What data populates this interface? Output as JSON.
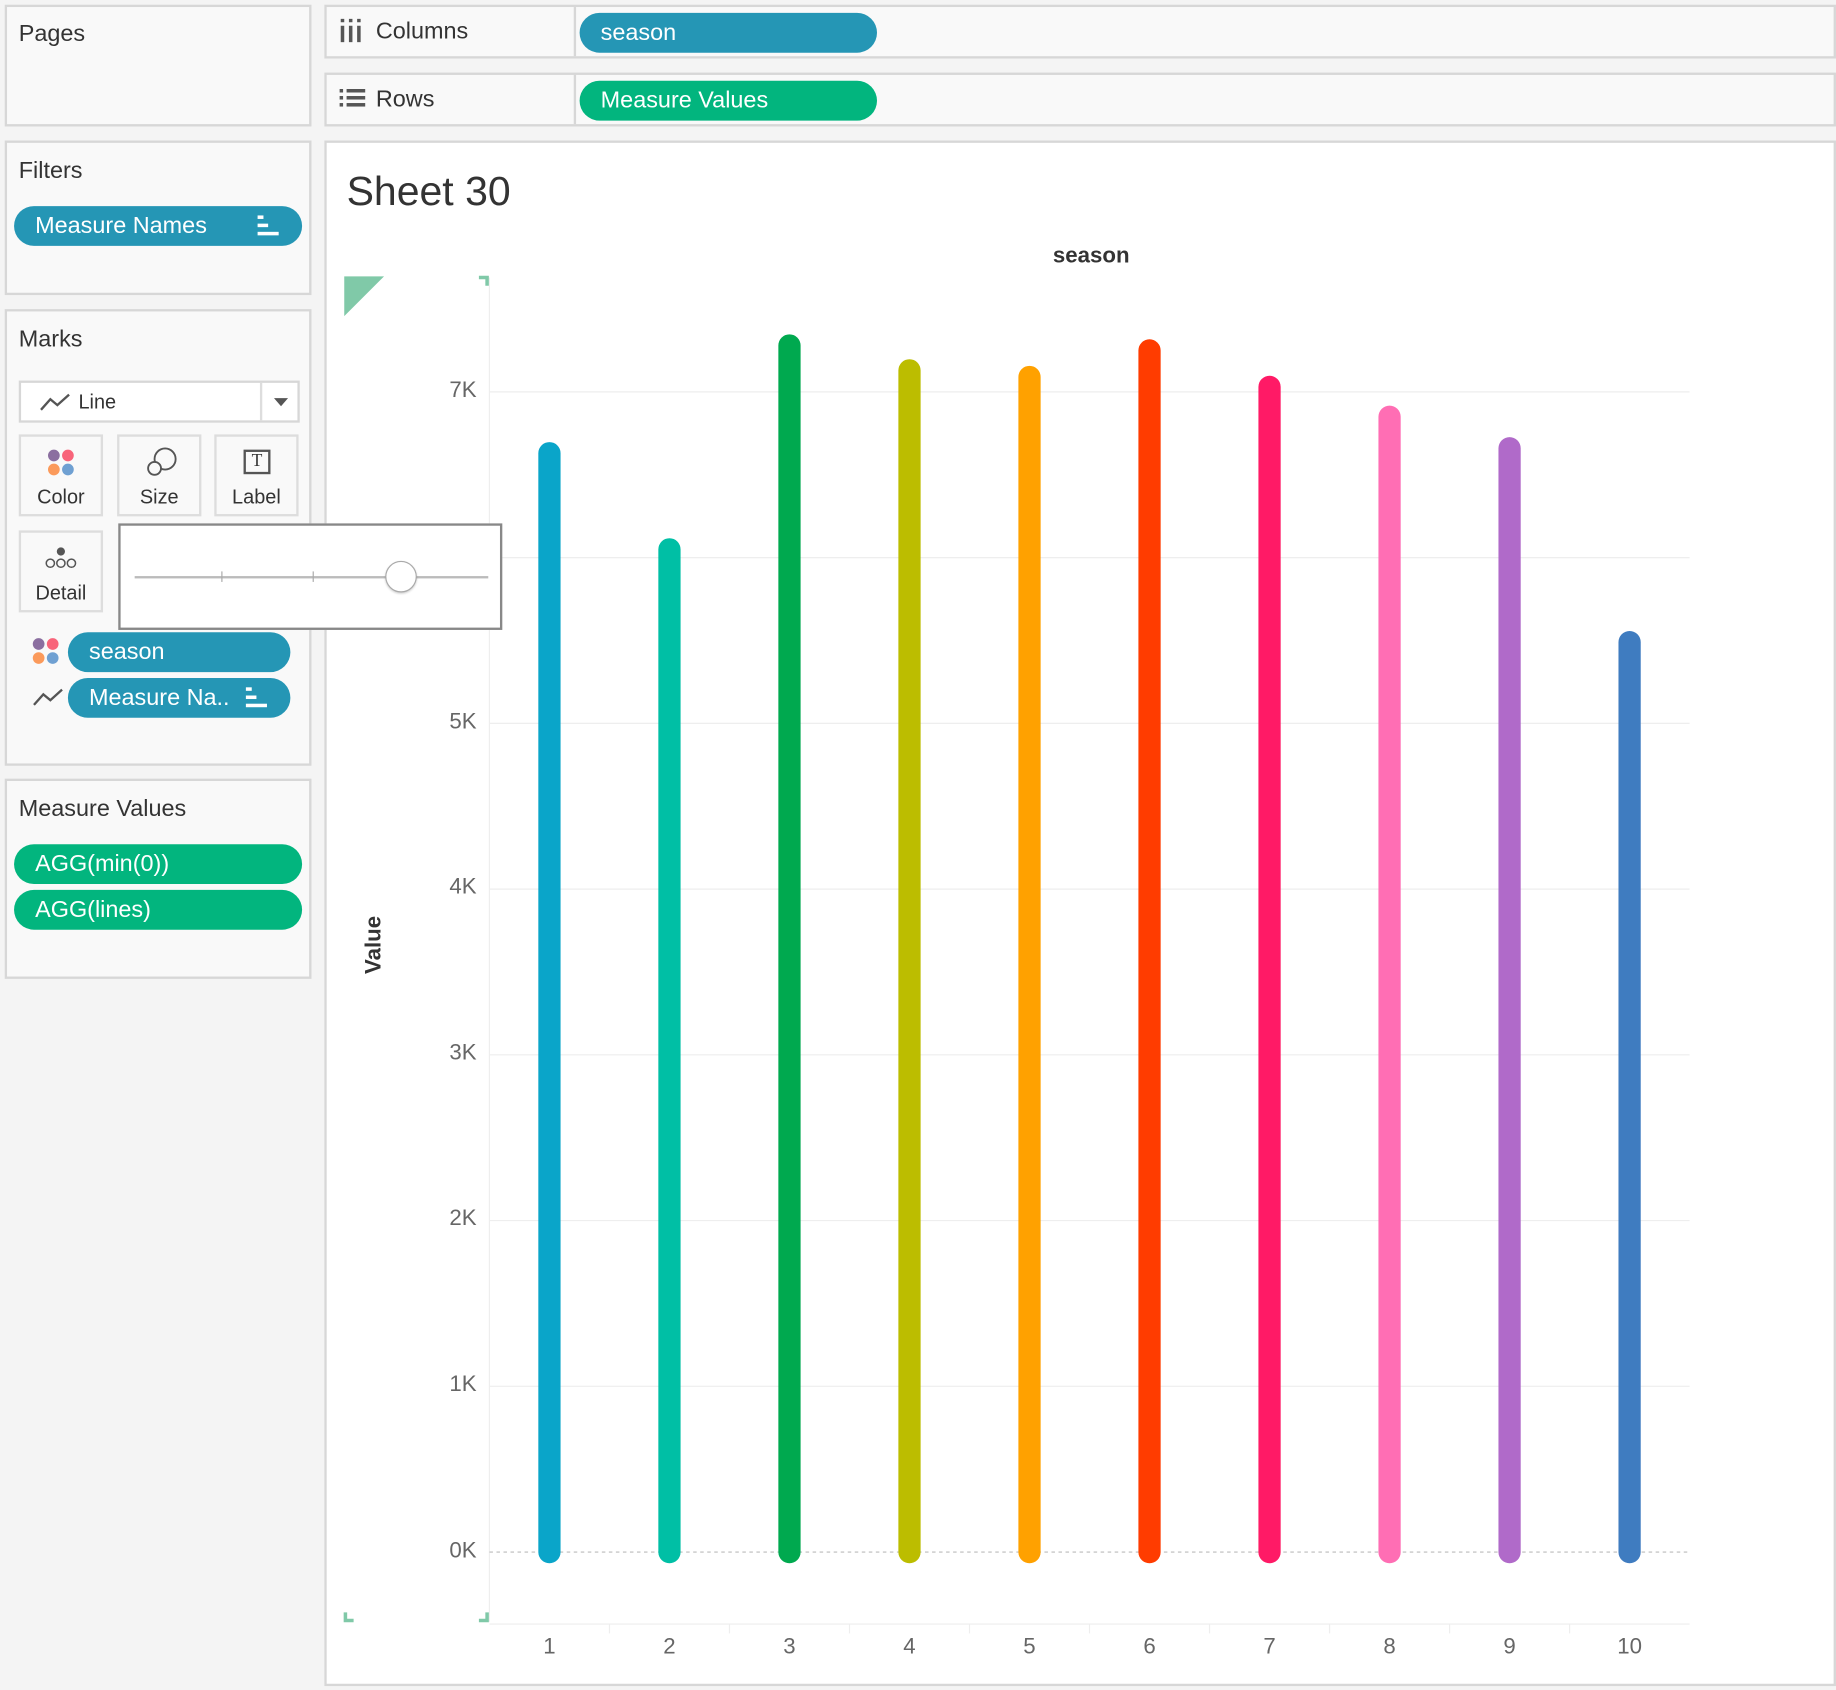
{
  "pages": {
    "title": "Pages"
  },
  "filters": {
    "title": "Filters",
    "pills": [
      "Measure Names"
    ]
  },
  "marks": {
    "title": "Marks",
    "mark_type": "Line",
    "buttons": {
      "color": "Color",
      "size": "Size",
      "label": "Label",
      "detail": "Detail"
    },
    "label_glyph": "T",
    "pills": [
      "season",
      "Measure Na.."
    ],
    "size_slider_value": 0.75
  },
  "measure_values": {
    "title": "Measure Values",
    "pills": [
      "AGG(min(0))",
      "AGG(lines)"
    ]
  },
  "shelves": {
    "columns": {
      "label": "Columns",
      "pill": "season"
    },
    "rows": {
      "label": "Rows",
      "pill": "Measure Values"
    }
  },
  "sheet": {
    "title": "Sheet 30"
  },
  "chart_data": {
    "type": "line",
    "title": "Sheet 30",
    "header": "season",
    "xlabel": "",
    "ylabel": "Value",
    "categories": [
      "1",
      "2",
      "3",
      "4",
      "5",
      "6",
      "7",
      "8",
      "9",
      "10"
    ],
    "series": [
      {
        "name": "AGG(min(0))",
        "values": [
          0,
          0,
          0,
          0,
          0,
          0,
          0,
          0,
          0,
          0
        ]
      },
      {
        "name": "AGG(lines)",
        "values": [
          6630,
          6050,
          7280,
          7130,
          7090,
          7250,
          7030,
          6850,
          6660,
          5490
        ]
      }
    ],
    "colors": [
      "#0aa5c9",
      "#00bfa5",
      "#00a94f",
      "#bcbd00",
      "#ffa100",
      "#ff3c00",
      "#ff1a66",
      "#ff6eb4",
      "#b06ac9",
      "#3f7cc0"
    ],
    "yticks": [
      {
        "v": 0,
        "label": "0K"
      },
      {
        "v": 1000,
        "label": "1K"
      },
      {
        "v": 2000,
        "label": "2K"
      },
      {
        "v": 3000,
        "label": "3K"
      },
      {
        "v": 4000,
        "label": "4K"
      },
      {
        "v": 5000,
        "label": "5K"
      },
      {
        "v": 6000,
        "label": ""
      },
      {
        "v": 7000,
        "label": "7K"
      }
    ],
    "ylim": [
      -420,
      7690
    ],
    "grid": true
  }
}
